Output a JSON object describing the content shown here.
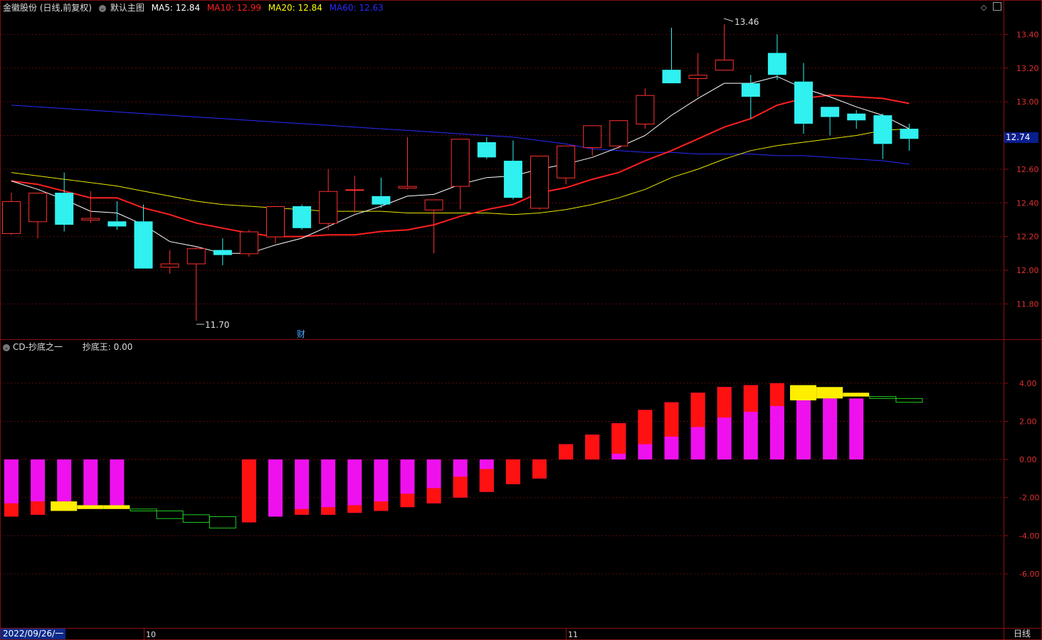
{
  "header": {
    "stock_label": "金徽股份 (日线,前复权)",
    "main_chart_label": "默认主图",
    "ma5": "MA5: 12.84",
    "ma10": "MA10: 12.99",
    "ma20": "MA20: 12.84",
    "ma60": "MA60: 12.63",
    "colors": {
      "ma5": "#ffffff",
      "ma10": "#ff2020",
      "ma20": "#ffff00",
      "ma60": "#2a2aff"
    }
  },
  "indicator": {
    "name": "CD-抄底之一",
    "value_label": "抄底王: 0.00"
  },
  "current_price": "12.74",
  "date_label": "2022/09/26/一",
  "period_label": "日线",
  "markers": {
    "high": "13.46",
    "low": "11.70",
    "finance": "财"
  },
  "month_labels": [
    "10",
    "11"
  ],
  "price_axis": [
    "13.40",
    "13.20",
    "13.00",
    "12.80",
    "12.60",
    "12.40",
    "12.20",
    "12.00",
    "11.80"
  ],
  "indicator_axis": [
    "4.00",
    "2.00",
    "0.00",
    "-2.00",
    "-4.00",
    "-6.00"
  ],
  "chart_data": {
    "type": "candlestick",
    "candles": [
      {
        "o": 12.22,
        "h": 12.46,
        "l": 12.21,
        "c": 12.41
      },
      {
        "o": 12.29,
        "h": 12.45,
        "l": 12.19,
        "c": 12.46
      },
      {
        "o": 12.46,
        "h": 12.58,
        "l": 12.23,
        "c": 12.27
      },
      {
        "o": 12.3,
        "h": 12.47,
        "l": 12.28,
        "c": 12.31
      },
      {
        "o": 12.29,
        "h": 12.41,
        "l": 12.24,
        "c": 12.26
      },
      {
        "o": 12.29,
        "h": 12.39,
        "l": 12.01,
        "c": 12.01
      },
      {
        "o": 12.02,
        "h": 12.12,
        "l": 11.98,
        "c": 12.04
      },
      {
        "o": 12.04,
        "h": 12.14,
        "l": 11.7,
        "c": 12.13
      },
      {
        "o": 12.12,
        "h": 12.19,
        "l": 12.03,
        "c": 12.09
      },
      {
        "o": 12.1,
        "h": 12.24,
        "l": 12.08,
        "c": 12.23
      },
      {
        "o": 12.2,
        "h": 12.38,
        "l": 12.16,
        "c": 12.38
      },
      {
        "o": 12.38,
        "h": 12.39,
        "l": 12.24,
        "c": 12.25
      },
      {
        "o": 12.28,
        "h": 12.6,
        "l": 12.24,
        "c": 12.47
      },
      {
        "o": 12.48,
        "h": 12.56,
        "l": 12.34,
        "c": 12.48
      },
      {
        "o": 12.44,
        "h": 12.55,
        "l": 12.37,
        "c": 12.39
      },
      {
        "o": 12.49,
        "h": 12.79,
        "l": 12.48,
        "c": 12.5
      },
      {
        "o": 12.36,
        "h": 12.42,
        "l": 12.1,
        "c": 12.42
      },
      {
        "o": 12.5,
        "h": 12.78,
        "l": 12.36,
        "c": 12.78
      },
      {
        "o": 12.76,
        "h": 12.79,
        "l": 12.66,
        "c": 12.67
      },
      {
        "o": 12.65,
        "h": 12.77,
        "l": 12.42,
        "c": 12.43
      },
      {
        "o": 12.37,
        "h": 12.68,
        "l": 12.36,
        "c": 12.68
      },
      {
        "o": 12.55,
        "h": 12.74,
        "l": 12.51,
        "c": 12.74
      },
      {
        "o": 12.73,
        "h": 12.86,
        "l": 12.68,
        "c": 12.86
      },
      {
        "o": 12.74,
        "h": 12.89,
        "l": 12.72,
        "c": 12.89
      },
      {
        "o": 12.87,
        "h": 13.08,
        "l": 12.84,
        "c": 13.04
      },
      {
        "o": 13.19,
        "h": 13.44,
        "l": 13.12,
        "c": 13.11
      },
      {
        "o": 13.14,
        "h": 13.29,
        "l": 13.03,
        "c": 13.16
      },
      {
        "o": 13.19,
        "h": 13.46,
        "l": 13.19,
        "c": 13.25
      },
      {
        "o": 13.11,
        "h": 13.16,
        "l": 12.9,
        "c": 13.03
      },
      {
        "o": 13.29,
        "h": 13.4,
        "l": 13.13,
        "c": 13.16
      },
      {
        "o": 13.12,
        "h": 13.23,
        "l": 12.81,
        "c": 12.87
      },
      {
        "o": 12.97,
        "h": 12.97,
        "l": 12.8,
        "c": 12.91
      },
      {
        "o": 12.93,
        "h": 12.95,
        "l": 12.84,
        "c": 12.89
      },
      {
        "o": 12.92,
        "h": 12.93,
        "l": 12.66,
        "c": 12.75
      },
      {
        "o": 12.84,
        "h": 12.87,
        "l": 12.71,
        "c": 12.78
      }
    ],
    "ma5": [
      12.53,
      12.48,
      12.42,
      12.35,
      12.34,
      12.27,
      12.17,
      12.14,
      12.1,
      12.1,
      12.15,
      12.19,
      12.26,
      12.33,
      12.38,
      12.44,
      12.45,
      12.51,
      12.55,
      12.56,
      12.6,
      12.63,
      12.67,
      12.73,
      12.8,
      12.92,
      13.02,
      13.11,
      13.11,
      13.15,
      13.08,
      13.03,
      12.97,
      12.92,
      12.84
    ],
    "ma10": [
      12.53,
      12.51,
      12.47,
      12.43,
      12.43,
      12.37,
      12.33,
      12.28,
      12.25,
      12.22,
      12.2,
      12.2,
      12.21,
      12.21,
      12.23,
      12.24,
      12.27,
      12.32,
      12.36,
      12.39,
      12.46,
      12.49,
      12.54,
      12.58,
      12.65,
      12.71,
      12.78,
      12.85,
      12.9,
      12.98,
      13.02,
      13.04,
      13.03,
      13.02,
      12.99
    ],
    "ma20": [
      12.58,
      12.56,
      12.54,
      12.52,
      12.5,
      12.47,
      12.44,
      12.41,
      12.39,
      12.38,
      12.37,
      12.36,
      12.35,
      12.35,
      12.35,
      12.34,
      12.34,
      12.34,
      12.34,
      12.33,
      12.34,
      12.36,
      12.39,
      12.43,
      12.48,
      12.55,
      12.6,
      12.66,
      12.71,
      12.74,
      12.76,
      12.78,
      12.8,
      12.83,
      12.84
    ],
    "ma60": [
      12.98,
      12.97,
      12.96,
      12.95,
      12.94,
      12.93,
      12.92,
      12.91,
      12.9,
      12.89,
      12.88,
      12.87,
      12.86,
      12.85,
      12.84,
      12.83,
      12.82,
      12.81,
      12.8,
      12.79,
      12.77,
      12.75,
      12.72,
      12.71,
      12.7,
      12.7,
      12.69,
      12.69,
      12.69,
      12.68,
      12.68,
      12.67,
      12.66,
      12.65,
      12.63
    ],
    "indicator_bars": [
      {
        "total": -3.0,
        "red": -0.7
      },
      {
        "total": -2.9,
        "red": -0.7
      },
      {
        "total": -2.2,
        "red": 0
      },
      {
        "total": -2.4,
        "red": 0
      },
      {
        "total": -2.4,
        "red": 0
      },
      {
        "total": 0,
        "red": 0
      },
      {
        "total": 0,
        "red": 0
      },
      {
        "total": 0,
        "red": 0
      },
      {
        "total": 0,
        "red": 0
      },
      {
        "total": -3.3,
        "red": -3.3
      },
      {
        "total": -3.0,
        "red": 0
      },
      {
        "total": -2.9,
        "red": -0.3
      },
      {
        "total": -2.9,
        "red": -0.4
      },
      {
        "total": -2.8,
        "red": -0.4
      },
      {
        "total": -2.7,
        "red": -0.5
      },
      {
        "total": -2.5,
        "red": -0.7
      },
      {
        "total": -2.3,
        "red": -0.8
      },
      {
        "total": -2.0,
        "red": -1.1
      },
      {
        "total": -1.7,
        "red": -1.2
      },
      {
        "total": -1.3,
        "red": -1.3
      },
      {
        "total": -1.0,
        "red": -1.0
      },
      {
        "total": 0.8,
        "red": 0.8
      },
      {
        "total": 1.3,
        "red": 1.3
      },
      {
        "total": 1.9,
        "red": 1.6
      },
      {
        "total": 2.6,
        "red": 1.8
      },
      {
        "total": 3.0,
        "red": 1.8
      },
      {
        "total": 3.5,
        "red": 1.8
      },
      {
        "total": 3.8,
        "red": 1.6
      },
      {
        "total": 3.9,
        "red": 1.4
      },
      {
        "total": 4.0,
        "red": 1.2
      },
      {
        "total": 3.1,
        "red": 0
      },
      {
        "total": 3.2,
        "red": 0
      },
      {
        "total": 3.2,
        "red": 0
      },
      {
        "total": 0,
        "red": 0
      },
      {
        "total": 0,
        "red": 0
      }
    ],
    "indicator_steps": [
      {
        "i": 2,
        "top": -2.2,
        "bot": -2.7,
        "color": "#ffee00",
        "filled": true
      },
      {
        "i": 3,
        "top": -2.4,
        "bot": -2.6,
        "color": "#ffee00",
        "filled": true
      },
      {
        "i": 4,
        "top": -2.4,
        "bot": -2.6,
        "color": "#ffee00",
        "filled": true
      },
      {
        "i": 5,
        "top": -2.6,
        "bot": -2.7,
        "color": "#22cc22",
        "filled": false
      },
      {
        "i": 6,
        "top": -2.7,
        "bot": -3.1,
        "color": "#22cc22",
        "filled": false
      },
      {
        "i": 7,
        "top": -2.9,
        "bot": -3.3,
        "color": "#22cc22",
        "filled": false
      },
      {
        "i": 8,
        "top": -3.0,
        "bot": -3.6,
        "color": "#22cc22",
        "filled": false
      },
      {
        "i": 30,
        "top": 3.9,
        "bot": 3.1,
        "color": "#ffee00",
        "filled": true
      },
      {
        "i": 31,
        "top": 3.8,
        "bot": 3.2,
        "color": "#ffee00",
        "filled": true
      },
      {
        "i": 32,
        "top": 3.5,
        "bot": 3.3,
        "color": "#ffee00",
        "filled": true
      },
      {
        "i": 33,
        "top": 3.3,
        "bot": 3.2,
        "color": "#22cc22",
        "filled": false
      },
      {
        "i": 34,
        "top": 3.2,
        "bot": 3.0,
        "color": "#22cc22",
        "filled": false
      }
    ],
    "price_range": [
      11.62,
      13.52
    ],
    "indicator_range": [
      -8.8,
      5.6
    ]
  }
}
